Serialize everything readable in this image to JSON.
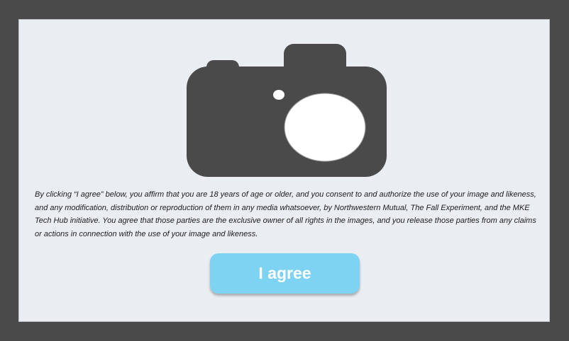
{
  "consent": {
    "text": "By clicking “I agree” below, you affirm that you are 18 years of age or older, and you consent to and authorize the use of your image and likeness, and any modification, distribution or reproduction of them in any media whatsoever, by Northwestern Mutual, The Fall Experiment, and the MKE Tech Hub initiative. You agree that those parties are the exclusive owner of all rights in the images, and you release those parties from any claims or actions in connection with the use of your image and likeness."
  },
  "agree_button": {
    "label": "I agree"
  },
  "camera_icon": {
    "name": "camera-icon",
    "body_color": "#4a4a4a",
    "lens_color": "#ffffff"
  },
  "colors": {
    "frame": "#4a4a4a",
    "panel": "#eaeef2",
    "button": "#7fd3f2"
  }
}
